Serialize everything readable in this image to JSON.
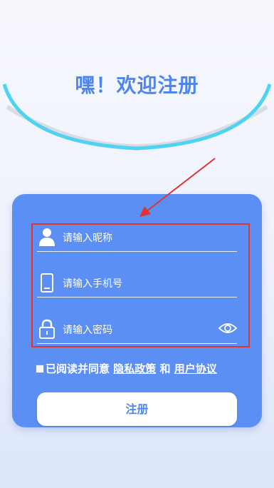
{
  "header": {
    "title": "嘿！欢迎注册"
  },
  "form": {
    "nickname_placeholder": "请输入昵称",
    "phone_placeholder": "请输入手机号",
    "password_placeholder": "请输入密码"
  },
  "agreement": {
    "prefix": "已阅读并同意",
    "privacy_link": "隐私政策",
    "conjunction": "和",
    "terms_link": "用户协议",
    "checked": false
  },
  "register_button": "注册",
  "icons": [
    "user-icon",
    "phone-icon",
    "lock-icon",
    "eye-icon"
  ],
  "colors": {
    "accent": "#5b8ff3",
    "title": "#4f86ee",
    "arc": "#4fd3f0",
    "annotation": "#e23333"
  }
}
